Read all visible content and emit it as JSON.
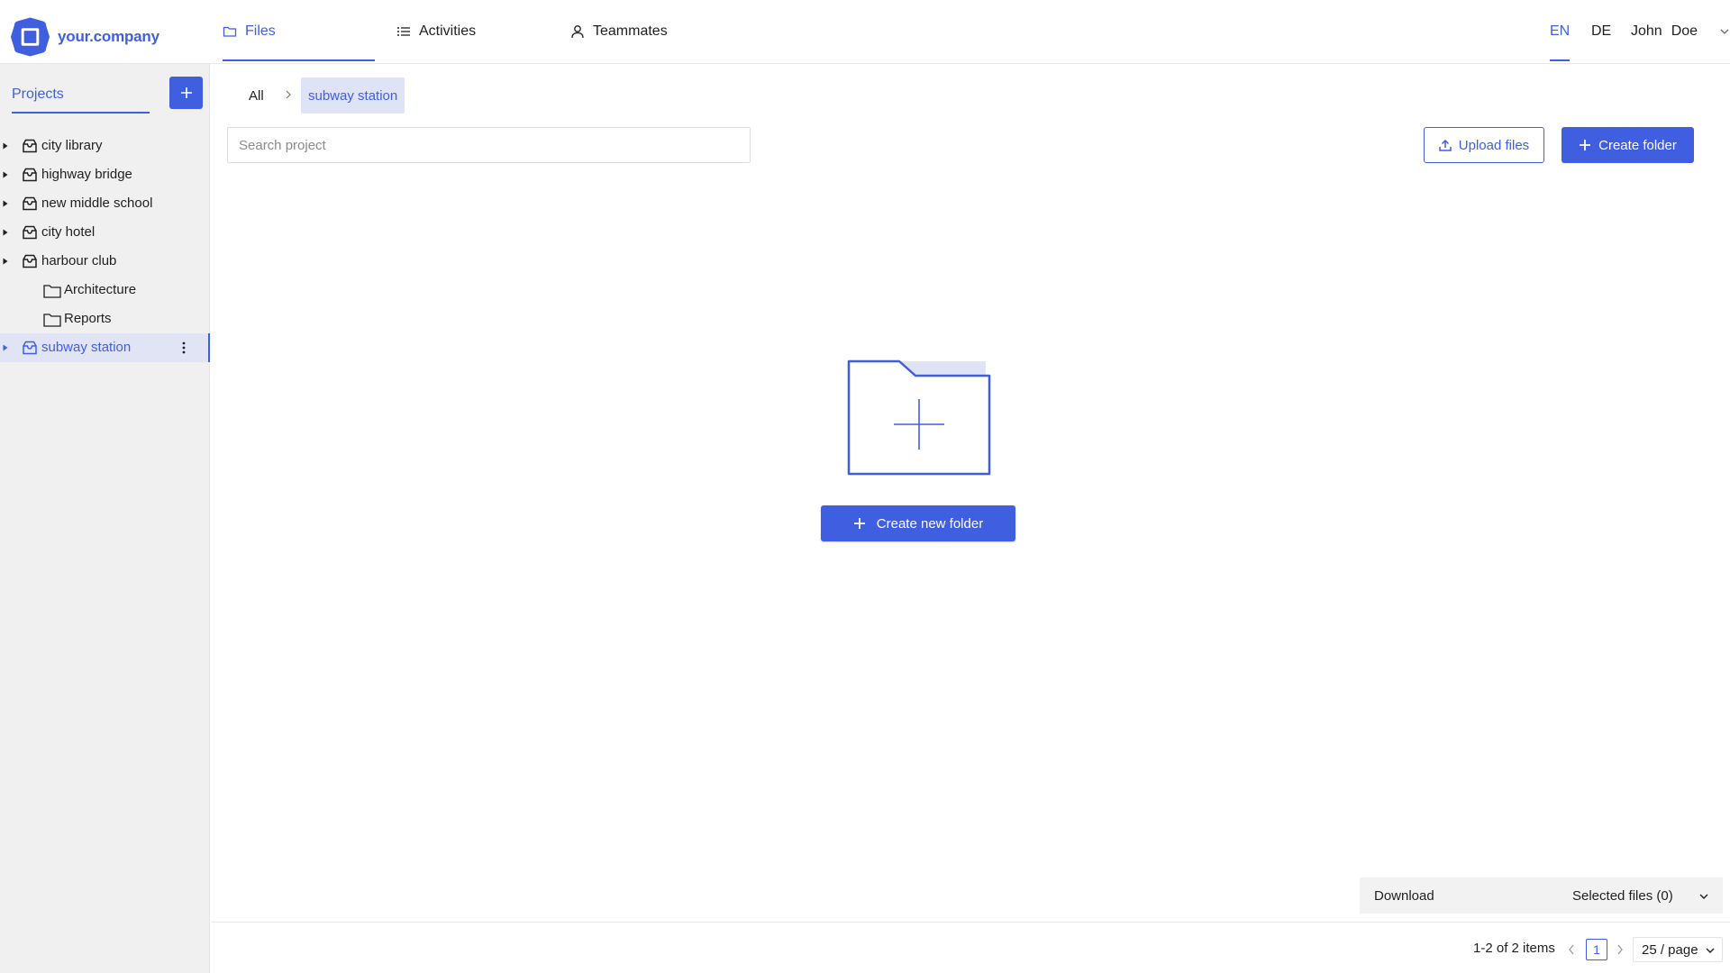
{
  "app": {
    "brand": "your.company",
    "brand_color": "#3f5fe0"
  },
  "nav": {
    "tabs": [
      {
        "label": "Files",
        "icon": "folder-icon",
        "active": true
      },
      {
        "label": "Activities",
        "icon": "list-icon",
        "active": false
      },
      {
        "label": "Teammates",
        "icon": "user-icon",
        "active": false
      }
    ],
    "languages": [
      {
        "label": "EN",
        "active": true
      },
      {
        "label": "DE",
        "active": false
      }
    ],
    "user": {
      "first": "John",
      "last": "Doe"
    }
  },
  "sidebar": {
    "tab_label": "Projects",
    "add_button_icon": "plus-icon",
    "projects": [
      {
        "label": "city library",
        "icon": "inbox-icon"
      },
      {
        "label": "highway bridge",
        "icon": "inbox-icon"
      },
      {
        "label": "new middle school",
        "icon": "inbox-icon"
      },
      {
        "label": "city hotel",
        "icon": "inbox-icon"
      },
      {
        "label": "harbour club",
        "icon": "inbox-icon",
        "expanded": true
      },
      {
        "label": "Architecture",
        "icon": "folder-icon",
        "child": true
      },
      {
        "label": "Reports",
        "icon": "folder-icon",
        "child": true
      },
      {
        "label": "subway station",
        "icon": "inbox-icon",
        "selected": true
      }
    ]
  },
  "breadcrumb": {
    "root": "All",
    "current": "subway station"
  },
  "search": {
    "placeholder": "Search project",
    "value": ""
  },
  "toolbar": {
    "upload_label": "Upload files",
    "create_folder_label": "Create folder"
  },
  "empty_state": {
    "illustration": "folder-plus-icon",
    "button_label": "Create new folder"
  },
  "download_bar": {
    "label": "Download",
    "selected": "Selected files (0)"
  },
  "pagination": {
    "info": "1-2 of 2 items",
    "current_page": "1",
    "page_size": "25 / page"
  }
}
